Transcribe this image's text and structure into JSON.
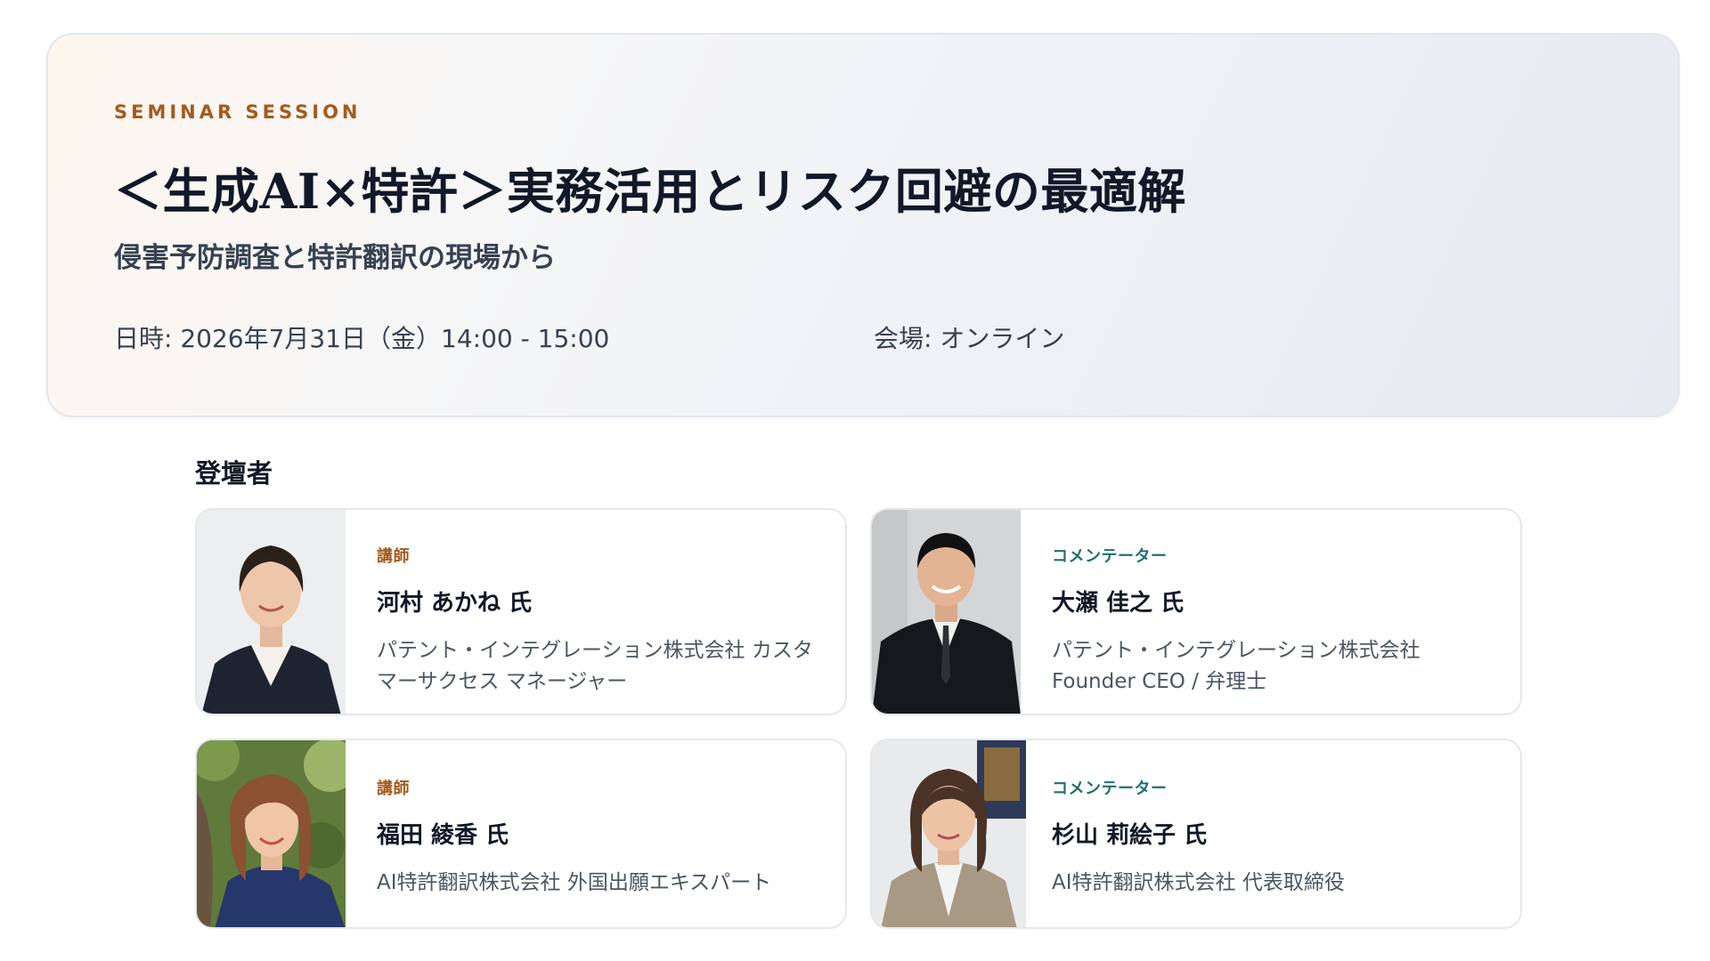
{
  "hero": {
    "eyebrow": "SEMINAR SESSION",
    "title": "＜生成AI×特許＞実務活用とリスク回避の最適解",
    "subtitle": "侵害予防調査と特許翻訳の現場から",
    "datetime": "日時: 2026年7月31日（金）14:00 - 15:00",
    "venue": "会場: オンライン"
  },
  "speakers_section": {
    "title": "登壇者",
    "speakers": [
      {
        "role": "講師",
        "name": "河村 あかね 氏",
        "affiliation": "パテント・インテグレーション株式会社 カスタマーサクセス マネージャー"
      },
      {
        "role": "コメンテーター",
        "name": "大瀬 佳之 氏",
        "affiliation_line1": "パテント・インテグレーション株式会社",
        "affiliation_line2": "Founder CEO / 弁理士"
      },
      {
        "role": "講師",
        "name": "福田 綾香 氏",
        "affiliation": "AI特許翻訳株式会社 外国出願エキスパート"
      },
      {
        "role": "コメンテーター",
        "name": "杉山 莉絵子 氏",
        "affiliation": "AI特許翻訳株式会社 代表取締役"
      }
    ]
  },
  "colors": {
    "accent_orange": "#a65a1c",
    "accent_teal": "#1f6f73",
    "title_text": "#111827",
    "body_text": "#4b5563"
  }
}
